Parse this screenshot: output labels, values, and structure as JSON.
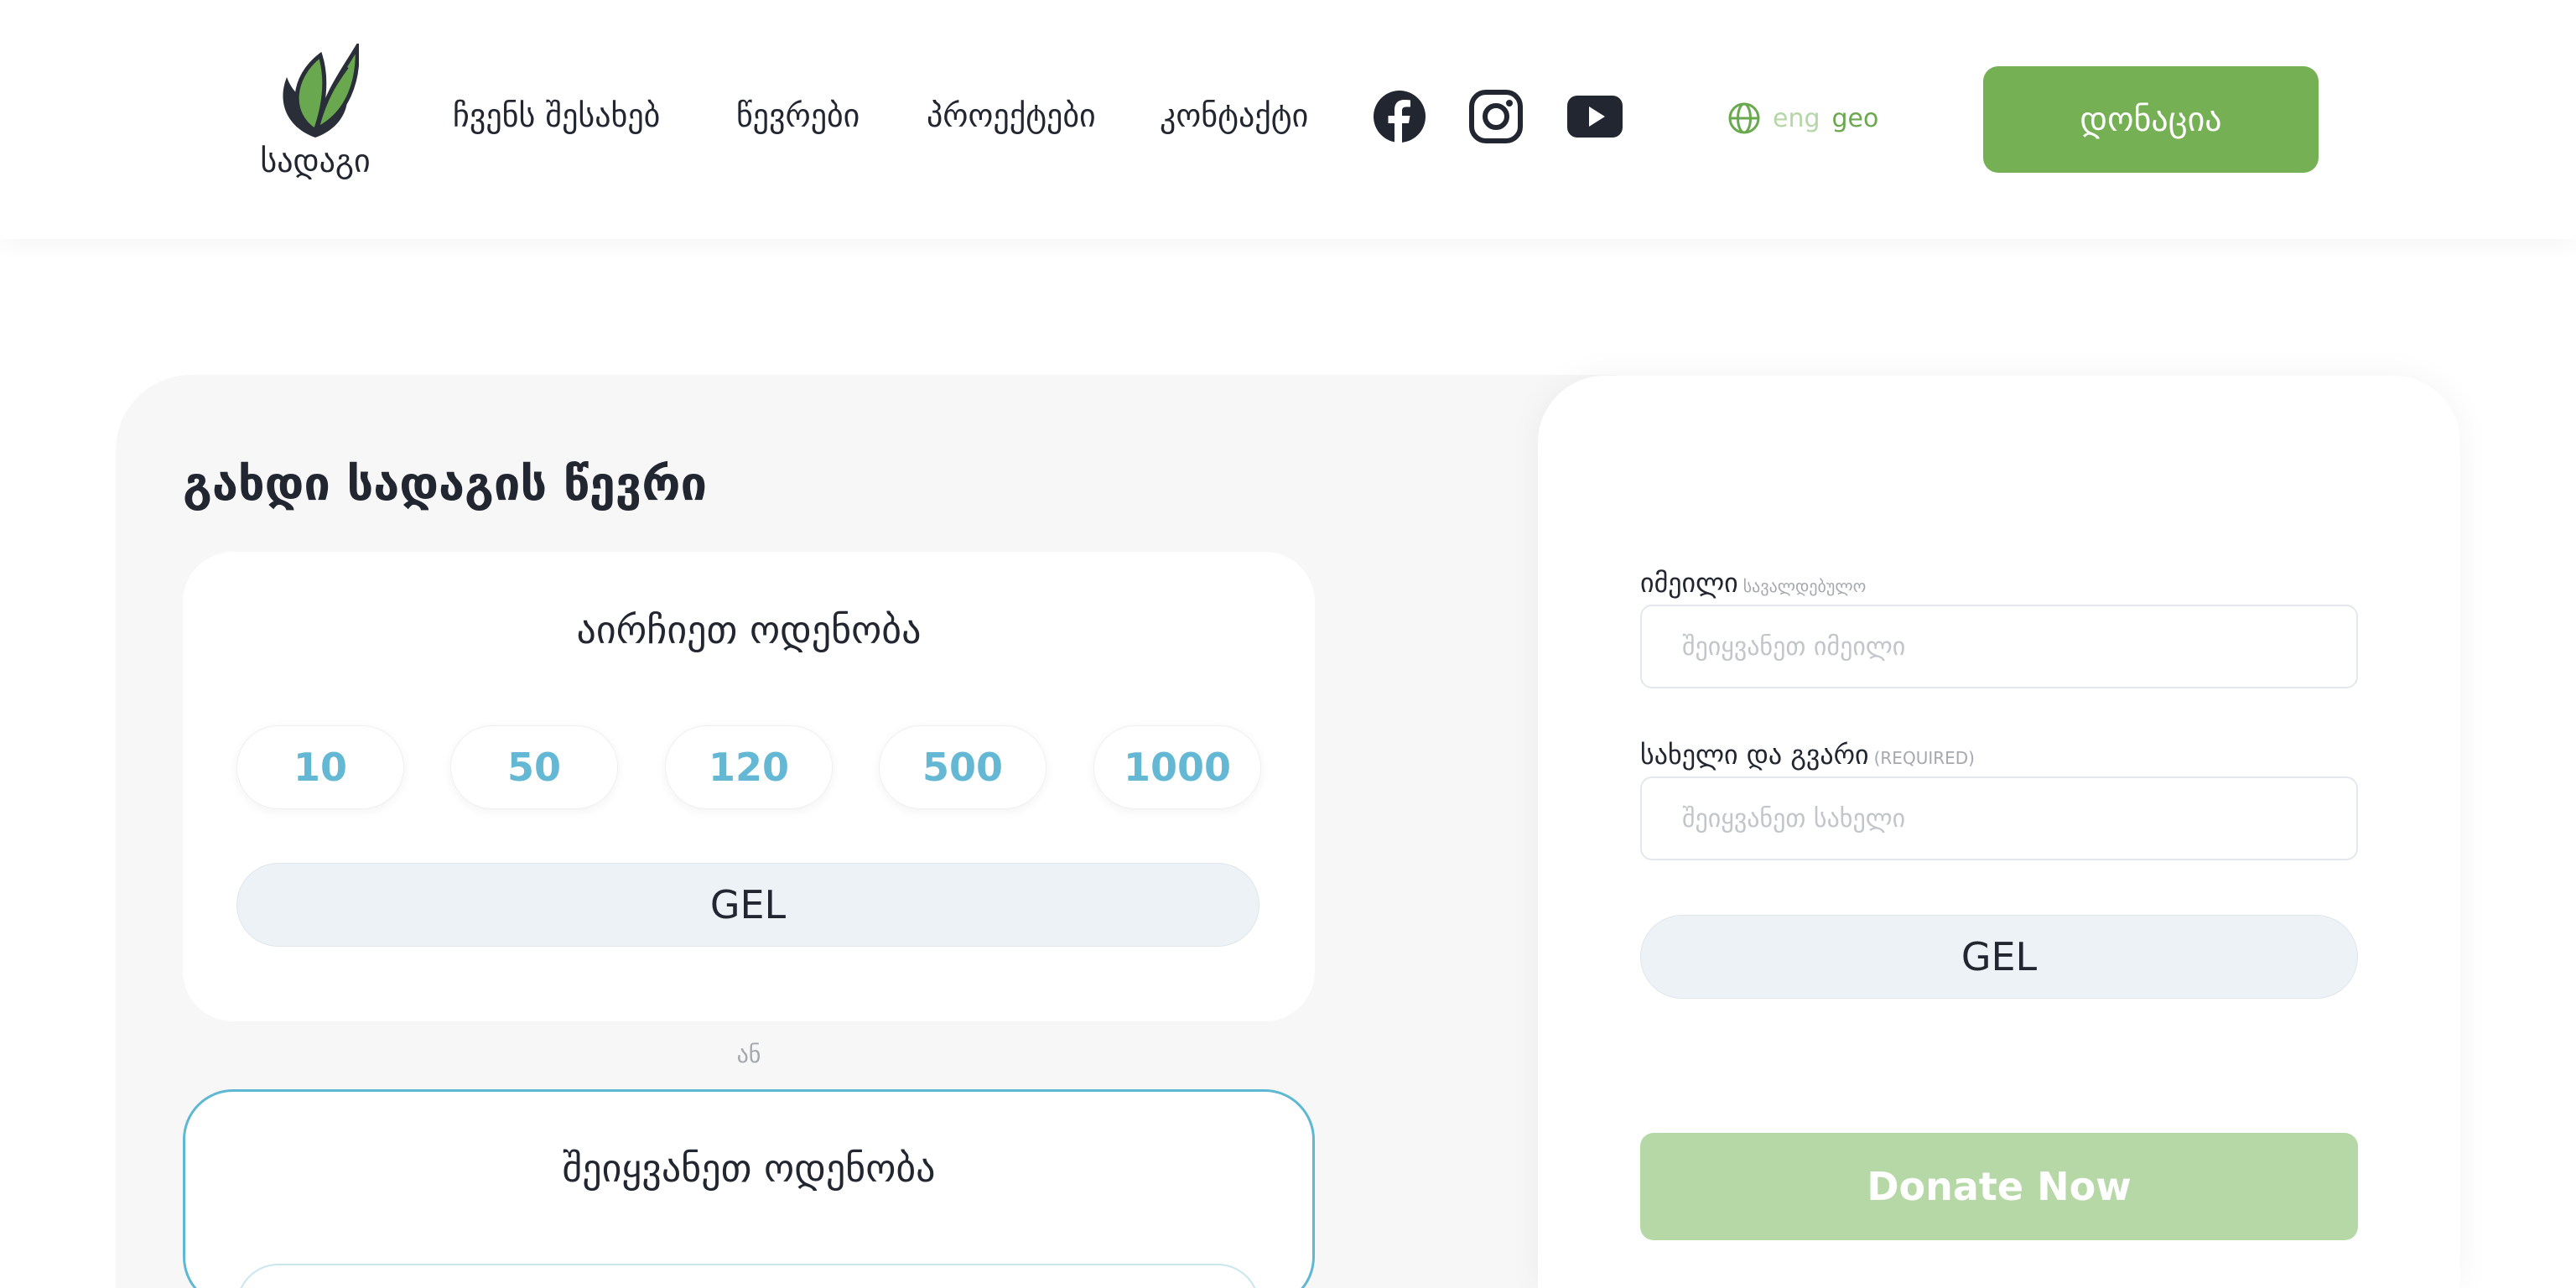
{
  "header": {
    "logo_text": "სადაგი",
    "nav": [
      "ჩვენს შესახებ",
      "წევრები",
      "პროექტები",
      "კონტაქტი"
    ],
    "social_icons": [
      "facebook-icon",
      "instagram-icon",
      "youtube-icon"
    ],
    "languages": [
      "eng",
      "geo"
    ],
    "active_language": "geo",
    "donate_label": "დონაცია"
  },
  "main": {
    "title": "გახდი სადაგის წევრი",
    "preset_card": {
      "heading": "აირჩიეთ ოდენობა",
      "amounts": [
        "10",
        "50",
        "120",
        "500",
        "1000"
      ],
      "currency": "GEL"
    },
    "or_text": "ან",
    "custom_card": {
      "heading": "შეიყვანეთ ოდენობა"
    }
  },
  "form": {
    "email": {
      "label": "იმეილი",
      "hint": "სავალდებულო",
      "placeholder": "შეიყვანეთ იმეილი"
    },
    "name": {
      "label": "სახელი და გვარი",
      "hint": "(REQUIRED)",
      "placeholder": "შეიყვანეთ სახელი"
    },
    "currency": "GEL",
    "submit_label": "Donate Now"
  },
  "colors": {
    "brand_green": "#76b054",
    "disabled_green": "#b6d8a6",
    "amount_blue": "#64b8d4",
    "panel_bg": "#f7f7f7",
    "text_dark": "#222631"
  }
}
